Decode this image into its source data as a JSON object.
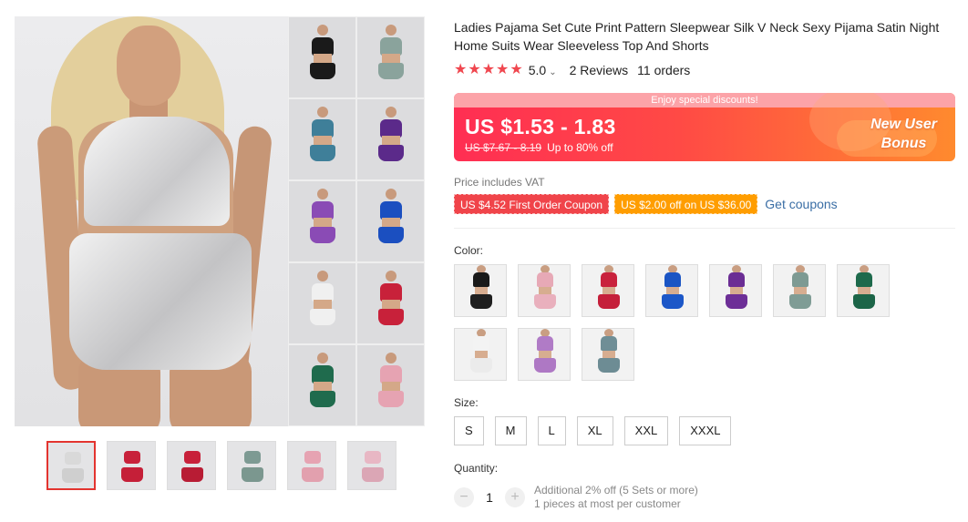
{
  "product": {
    "title": "Ladies Pajama Set Cute Print Pattern Sleepwear Silk V Neck Sexy Pijama Satin Night Home Suits Wear Sleeveless Top And Shorts"
  },
  "rating": {
    "score": "5.0",
    "stars": 5,
    "reviews": "2 Reviews",
    "orders": "11 orders"
  },
  "promo": {
    "banner": "Enjoy special discounts!",
    "price": "US $1.53 - 1.83",
    "original_price": "US $7.67 - 8.19",
    "discount": "Up to 80% off",
    "new_user_line1": "New User",
    "new_user_line2": "Bonus",
    "gradient_start": "#ff2e53",
    "gradient_end": "#ff8a2e"
  },
  "vat_note": "Price includes VAT",
  "coupons": {
    "first_order": "US $4.52 First Order Coupon",
    "store": "US $2.00 off on US $36.00",
    "get_link": "Get coupons"
  },
  "color": {
    "label": "Color:",
    "options": [
      {
        "name": "black",
        "top": "#1a1a1a",
        "shorts": "#1f1f1f"
      },
      {
        "name": "pink",
        "top": "#e7a9b6",
        "shorts": "#e9b0bd"
      },
      {
        "name": "red",
        "top": "#c9223d",
        "shorts": "#c51f3a"
      },
      {
        "name": "blue",
        "top": "#1b55c4",
        "shorts": "#1c57c8"
      },
      {
        "name": "purple",
        "top": "#6b2d94",
        "shorts": "#6d2f97"
      },
      {
        "name": "grey-green",
        "top": "#7d9a93",
        "shorts": "#7f9c95"
      },
      {
        "name": "dark-green",
        "top": "#1e6a4c",
        "shorts": "#1c6548"
      },
      {
        "name": "white",
        "top": "#f3f3f3",
        "shorts": "#ebebeb"
      },
      {
        "name": "lilac",
        "top": "#b07bc6",
        "shorts": "#ae78c4"
      },
      {
        "name": "teal-grey",
        "top": "#6f8e96",
        "shorts": "#6d8c94"
      }
    ]
  },
  "size": {
    "label": "Size:",
    "options": [
      "S",
      "M",
      "L",
      "XL",
      "XXL",
      "XXXL"
    ]
  },
  "quantity": {
    "label": "Quantity:",
    "value": "1",
    "minus": "−",
    "plus": "+",
    "note1": "Additional 2% off (5 Sets or more)",
    "note2": "1 pieces at most per customer"
  },
  "gallery": {
    "grid": [
      [
        "#1a1a1a",
        "#8aa39c"
      ],
      [
        "#3f7f99",
        "#5b2a8a"
      ],
      [
        "#8a4bb5",
        "#1b4fc0"
      ],
      [
        "#f0f0f0",
        "#c8213a"
      ],
      [
        "#1f6b4d",
        "#e6a3b2"
      ]
    ],
    "thumbs": [
      {
        "top": "#d9d9d9",
        "shorts": "#cfcfcf"
      },
      {
        "top": "#c8213a",
        "shorts": "#c51f38"
      },
      {
        "top": "#c8213a",
        "shorts": "#b81c34"
      },
      {
        "top": "#7d9a93",
        "shorts": "#7b978f"
      },
      {
        "top": "#e6a3b2",
        "shorts": "#e2a0ae"
      },
      {
        "top": "#e8b7c4",
        "shorts": "#dba6b5"
      }
    ]
  },
  "icons": {
    "star": "★",
    "caret": "⌄"
  }
}
